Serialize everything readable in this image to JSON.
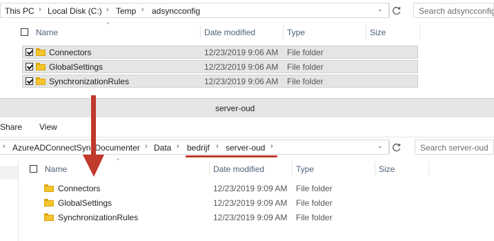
{
  "top_window": {
    "breadcrumbs": [
      "This PC",
      "Local Disk (C:)",
      "Temp",
      "adsyncconfig"
    ],
    "search_placeholder": "Search adsyncconfig",
    "columns": {
      "name": "Name",
      "date": "Date modified",
      "type": "Type",
      "size": "Size"
    },
    "rows": [
      {
        "name": "Connectors",
        "date": "12/23/2019 9:06 AM",
        "type": "File folder",
        "checked": true
      },
      {
        "name": "GlobalSettings",
        "date": "12/23/2019 9:06 AM",
        "type": "File folder",
        "checked": true
      },
      {
        "name": "SynchronizationRules",
        "date": "12/23/2019 9:06 AM",
        "type": "File folder",
        "checked": true
      }
    ]
  },
  "bottom_window": {
    "title": "server-oud",
    "ribbon": [
      "Share",
      "View"
    ],
    "breadcrumbs": [
      "AzureADConnectSyncDocumenter",
      "Data",
      "bedrijf",
      "server-oud"
    ],
    "search_placeholder": "Search server-oud",
    "columns": {
      "name": "Name",
      "date": "Date modified",
      "type": "Type",
      "size": "Size"
    },
    "rows": [
      {
        "name": "Connectors",
        "date": "12/23/2019 9:09 AM",
        "type": "File folder"
      },
      {
        "name": "GlobalSettings",
        "date": "12/23/2019 9:09 AM",
        "type": "File folder"
      },
      {
        "name": "SynchronizationRules",
        "date": "12/23/2019 9:09 AM",
        "type": "File folder"
      }
    ]
  },
  "annotation_color": "#c0392b",
  "icons": [
    "chevron-right-icon",
    "chevron-down-icon",
    "refresh-icon",
    "folder-icon",
    "sort-up-icon",
    "arrow-down-icon"
  ]
}
